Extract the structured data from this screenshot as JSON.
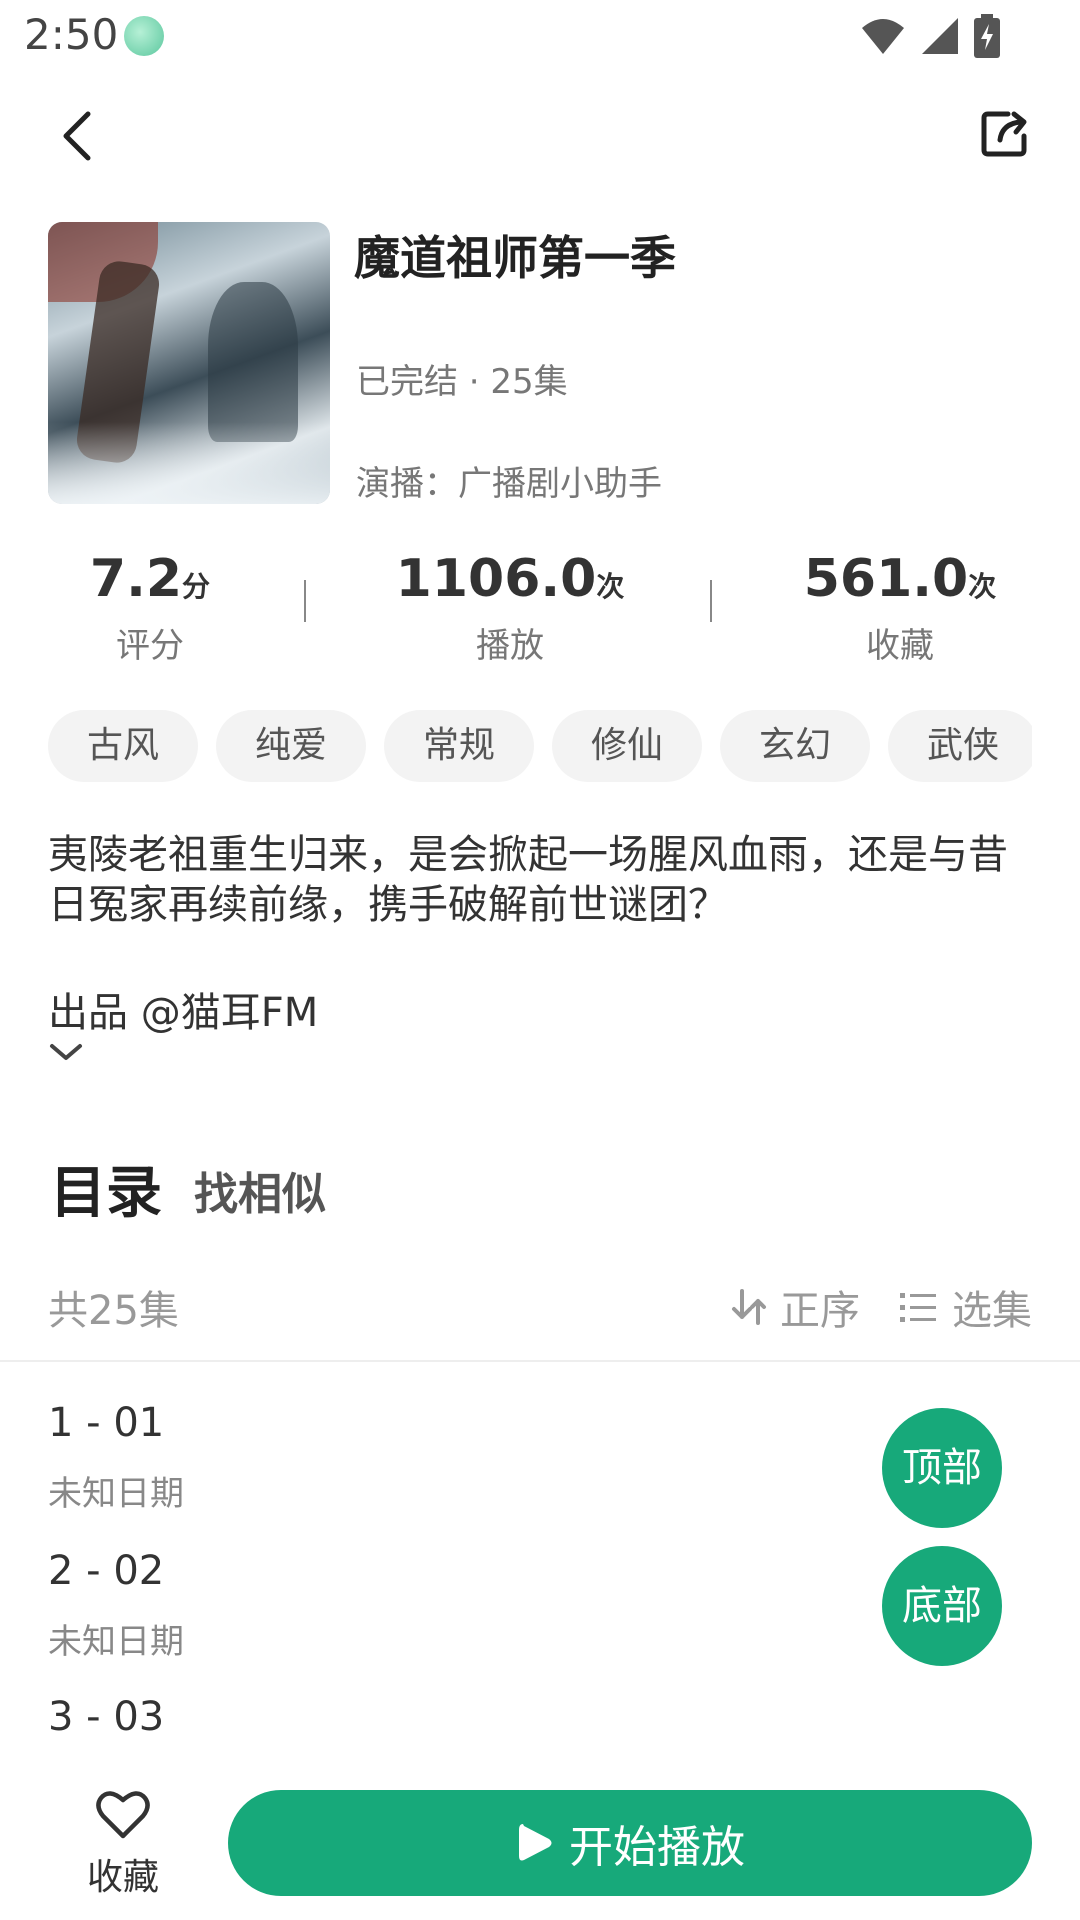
{
  "status_bar": {
    "time": "2:50"
  },
  "header": {
    "back_icon": "chevron-left-icon",
    "share_icon": "share-icon"
  },
  "drama": {
    "title": "魔道祖师第一季",
    "status": "已完结 · 25集",
    "cast": "演播：广播剧小助手"
  },
  "stats": {
    "rating": {
      "value": "7.2",
      "unit": "分",
      "label": "评分"
    },
    "plays": {
      "value": "1106.0",
      "unit": "次",
      "label": "播放"
    },
    "favorites": {
      "value": "561.0",
      "unit": "次",
      "label": "收藏"
    }
  },
  "tags": [
    "古风",
    "纯爱",
    "常规",
    "修仙",
    "玄幻",
    "武侠"
  ],
  "description": "夷陵老祖重生归来，是会掀起一场腥风血雨，还是与昔日冤家再续前缘，携手破解前世谜团？",
  "producer": "出品 @猫耳FM",
  "tabs": {
    "catalog": "目录",
    "similar": "找相似"
  },
  "list": {
    "count": "共25集",
    "sort_label": "正序",
    "select_label": "选集",
    "episodes": [
      {
        "title": "1 - 01",
        "date": "未知日期"
      },
      {
        "title": "2 - 02",
        "date": "未知日期"
      },
      {
        "title": "3 - 03",
        "date": ""
      }
    ]
  },
  "floating": {
    "top_label": "顶部",
    "bottom_label": "底部"
  },
  "bottom_bar": {
    "favorite_label": "收藏",
    "play_label": "开始播放"
  },
  "colors": {
    "accent": "#17a97a"
  }
}
